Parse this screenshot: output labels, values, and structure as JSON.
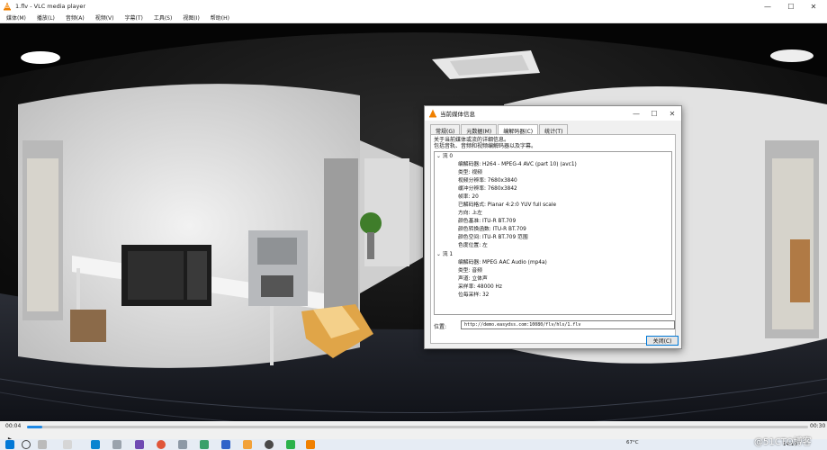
{
  "window": {
    "title": "1.flv - VLC media player",
    "minimize": "—",
    "maximize": "☐",
    "close": "✕"
  },
  "menu": [
    "媒体(M)",
    "播放(L)",
    "音频(A)",
    "视频(V)",
    "字幕(T)",
    "工具(S)",
    "视图(I)",
    "帮助(H)"
  ],
  "dialog": {
    "title": "当前媒体信息",
    "minimize": "—",
    "maximize": "☐",
    "close": "✕",
    "tabs": [
      "常规(G)",
      "元数据(M)",
      "编解码器(C)",
      "统计(T)"
    ],
    "active_tab": 2,
    "description_line1": "关于当前媒体或流的详细信息。",
    "description_line2": "包括音轨、音频和视频编解码器以及字幕。",
    "stream0": {
      "header": "流 0",
      "rows": [
        "编解码器: H264 - MPEG-4 AVC (part 10) (avc1)",
        "类型: 视频",
        "视频分辨率: 7680x3840",
        "缓冲分辨率: 7680x3842",
        "帧率: 20",
        "已解码格式: Planar 4:2:0 YUV full scale",
        "方向: 上左",
        "颜色基准: ITU-R BT.709",
        "颜色转换函数: ITU-R BT.709",
        "颜色空间: ITU-R BT.709 范围",
        "色度位置: 左"
      ]
    },
    "stream1": {
      "header": "流 1",
      "rows": [
        "编解码器: MPEG AAC Audio (mp4a)",
        "类型: 音频",
        "声道: 立体声",
        "采样率: 48000 Hz",
        "位每采样: 32"
      ]
    },
    "location_label": "位置:",
    "location_value": "http://demo.easydss.com:10080/flv/hls/1.flv",
    "close_button": "关闭(C)"
  },
  "controls": {
    "time_current": "00:04",
    "time_total": "00:30",
    "progress": 0.02
  },
  "taskbar": {
    "temperature": "67°C",
    "time": "14:10"
  },
  "watermark": "@51CTO博客",
  "colors": {
    "accent": "#1e88e5",
    "vlc_orange": "#f08000"
  }
}
